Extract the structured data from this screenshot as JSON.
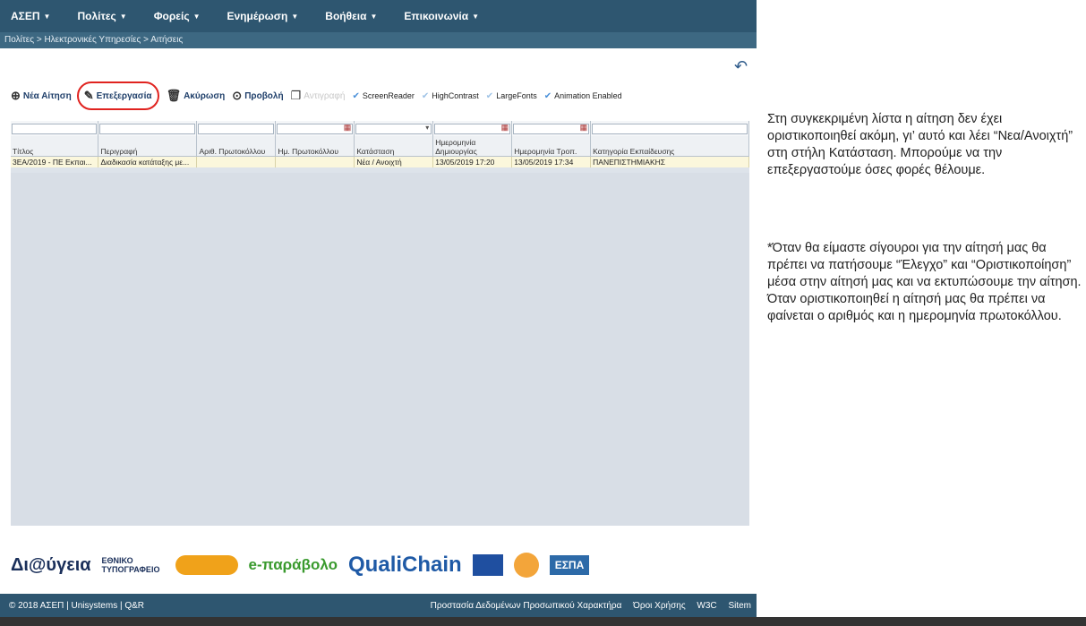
{
  "nav": {
    "items": [
      {
        "label": "ΑΣΕΠ"
      },
      {
        "label": "Πολίτες"
      },
      {
        "label": "Φορείς"
      },
      {
        "label": "Ενημέρωση"
      },
      {
        "label": "Βοήθεια"
      },
      {
        "label": "Επικοινωνία"
      }
    ]
  },
  "breadcrumb": "Πολίτες > Ηλεκτρονικές Υπηρεσίες > Αιτήσεις",
  "toolbar": {
    "new_label": "Νέα Αίτηση",
    "edit_label": "Επεξεργασία",
    "cancel_label": "Ακύρωση",
    "view_label": "Προβολή",
    "copy_label": "Αντιγραφή",
    "checks": [
      {
        "label": "ScreenReader"
      },
      {
        "label": "HighContrast"
      },
      {
        "label": "LargeFonts"
      },
      {
        "label": "Animation Enabled"
      }
    ]
  },
  "table": {
    "headers": [
      "Τίτλος",
      "Περιγραφή",
      "Αριθ. Πρωτοκόλλου",
      "Ημ. Πρωτοκόλλου",
      "Κατάσταση",
      "Ημερομηνία Δημιουργίας",
      "Ημερομηνία Τροπ.",
      "Κατηγορία Εκπαίδευσης"
    ],
    "rows": [
      [
        "3ΕΑ/2019 - ΠΕ Εκπαι...",
        "Διαδικασία κατάταξης με...",
        "",
        "",
        "Νέα / Ανοιχτή",
        "13/05/2019 17:20",
        "13/05/2019 17:34",
        "ΠΑΝΕΠΙΣΤΗΜΙΑΚΗΣ"
      ]
    ]
  },
  "footer": {
    "copyright": "© 2018 ΑΣΕΠ | Unisystems | Q&R",
    "links": [
      "Προστασία Δεδομένων Προσωπικού Χαρακτήρα",
      "Όροι Χρήσης",
      "W3C",
      "Sitem"
    ],
    "logos": [
      "Δι@ύγεια",
      "ΕΘΝΙΚΟ ΤΥΠΟΓΡΑΦΕΙΟ",
      "e-παράβολο",
      "QualiChain",
      "ΕΣΠΑ"
    ]
  },
  "notes": {
    "p1": "Στη συγκεκριμένη λίστα η αίτηση δεν έχει οριστικοποιηθεί ακόμη, γι’ αυτό και λέει “Νεα/Ανοιχτή” στη στήλη Κατάσταση. Μπορούμε να την επεξεργαστούμε όσες φορές θέλουμε.",
    "p2": "*Όταν θα είμαστε σίγουροι για την αίτησή μας θα πρέπει να πατήσουμε “Έλεγχο” και “Οριστικοποίηση” μέσα στην αίτησή μας και να εκτυπώσουμε την αίτηση. Όταν οριστικοποιηθεί η αίτησή μας θα πρέπει να φαίνεται ο αριθμός και η ημερομηνία πρωτοκόλλου."
  }
}
